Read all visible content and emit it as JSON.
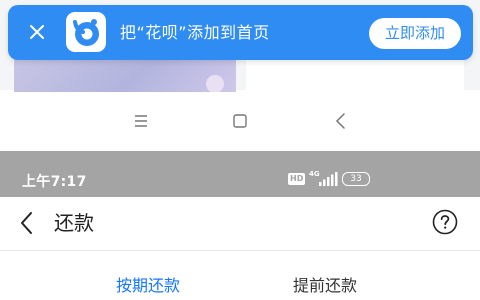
{
  "banner": {
    "text": "把“花呗”添加到首页",
    "add_button_label": "立即添加",
    "close_icon": "close-icon",
    "app_icon": "huabei-app-icon"
  },
  "system_nav": {
    "menu_icon": "menu-icon",
    "home_icon": "home-square-icon",
    "back_icon": "back-chevron-icon"
  },
  "status_bar": {
    "time": "上午7:17",
    "hd_badge": "HD",
    "network": "4G",
    "battery": "33"
  },
  "header": {
    "title": "还款",
    "back_icon": "back-arrow-icon",
    "help_icon": "help-circle-icon"
  },
  "tabs": [
    {
      "label": "按期还款",
      "active": true
    },
    {
      "label": "提前还款",
      "active": false
    }
  ],
  "colors": {
    "banner_blue": "#2f8cf3",
    "active_tab": "#1677ff",
    "status_bar_bg": "#a4a4a4"
  }
}
